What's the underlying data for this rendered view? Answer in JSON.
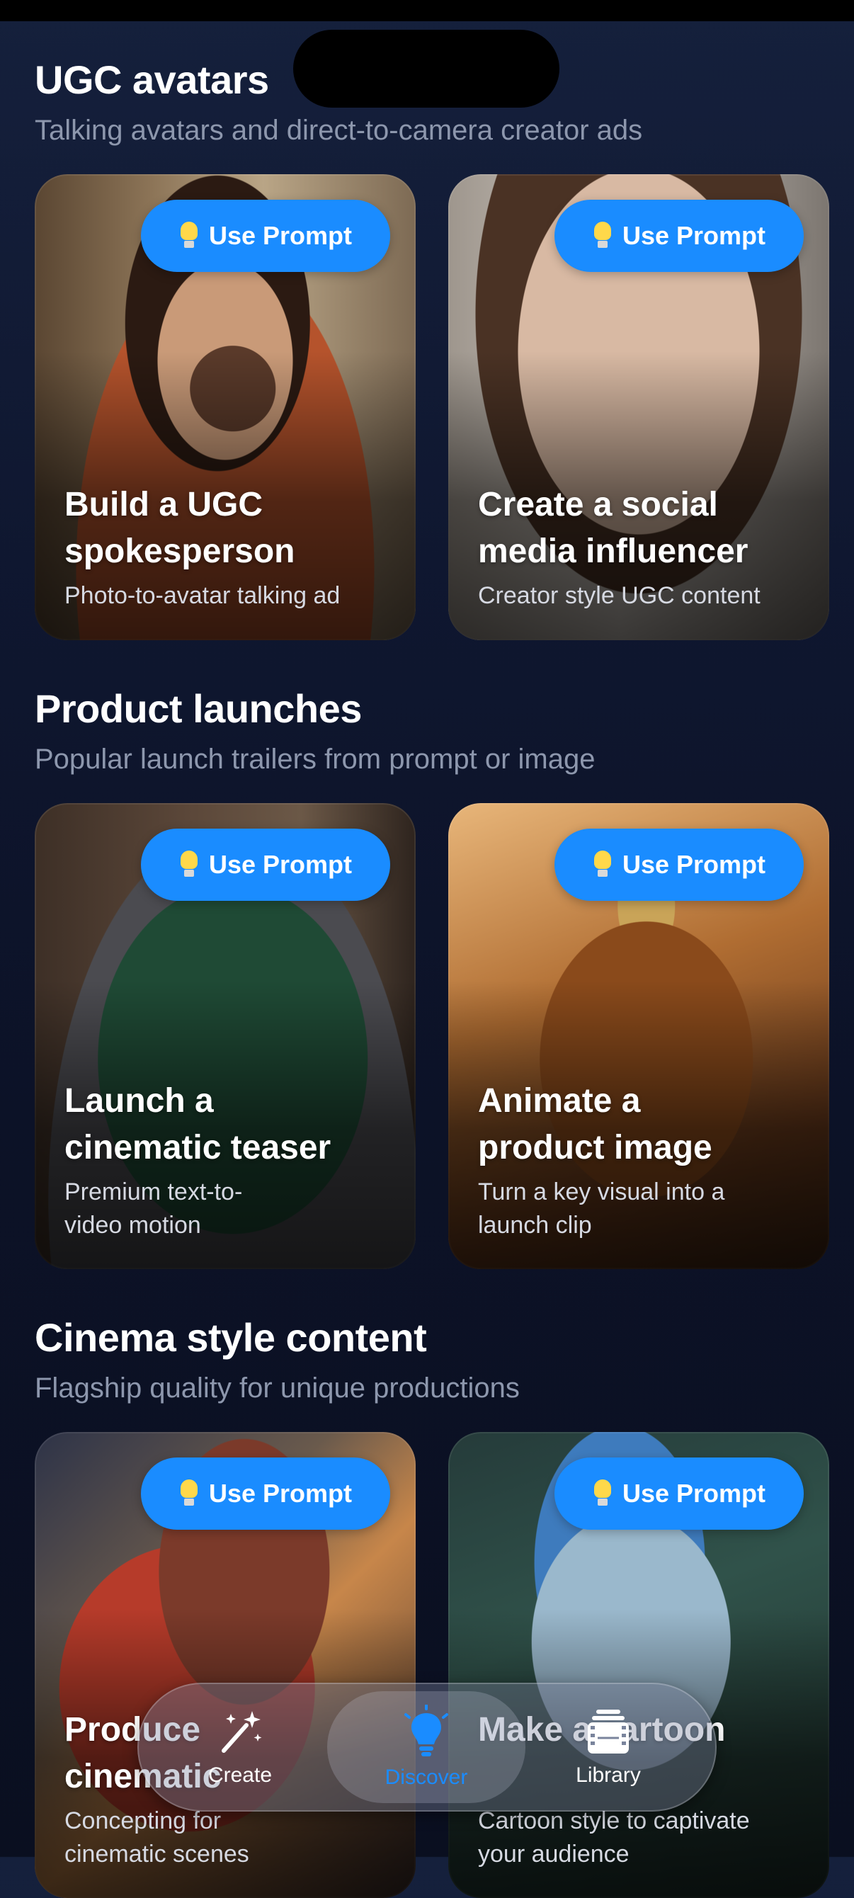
{
  "sections": [
    {
      "title": "UGC avatars",
      "subtitle": "Talking avatars and direct-to-camera creator ads",
      "cards": [
        {
          "title": "Build a UGC spokesperson",
          "subtitle": "Photo-to-avatar talking ad",
          "button": "Use Prompt"
        },
        {
          "title": "Create a social media influencer",
          "subtitle": "Creator style UGC content",
          "button": "Use Prompt"
        }
      ]
    },
    {
      "title": "Product launches",
      "subtitle": "Popular launch trailers from prompt or image",
      "cards": [
        {
          "title": "Launch a cinematic teaser",
          "subtitle": "Premium text-to-video motion",
          "button": "Use Prompt"
        },
        {
          "title": "Animate a product image",
          "subtitle": "Turn a key visual into a launch clip",
          "button": "Use Prompt"
        }
      ]
    },
    {
      "title": "Cinema style content",
      "subtitle": "Flagship quality for unique productions",
      "cards": [
        {
          "title": "Produce cinematic",
          "subtitle": "Concepting for cinematic scenes",
          "button": "Use Prompt"
        },
        {
          "title": "Make a cartoon",
          "subtitle": "Cartoon style to captivate your audience",
          "button": "Use Prompt"
        }
      ]
    }
  ],
  "tabbar": {
    "items": [
      {
        "label": "Create",
        "icon": "magic-wand-icon"
      },
      {
        "label": "Discover",
        "icon": "lightbulb-icon",
        "active": true
      },
      {
        "label": "Library",
        "icon": "film-stack-icon"
      }
    ]
  },
  "colors": {
    "accent": "#1a8cff",
    "background": "#0f1730"
  }
}
